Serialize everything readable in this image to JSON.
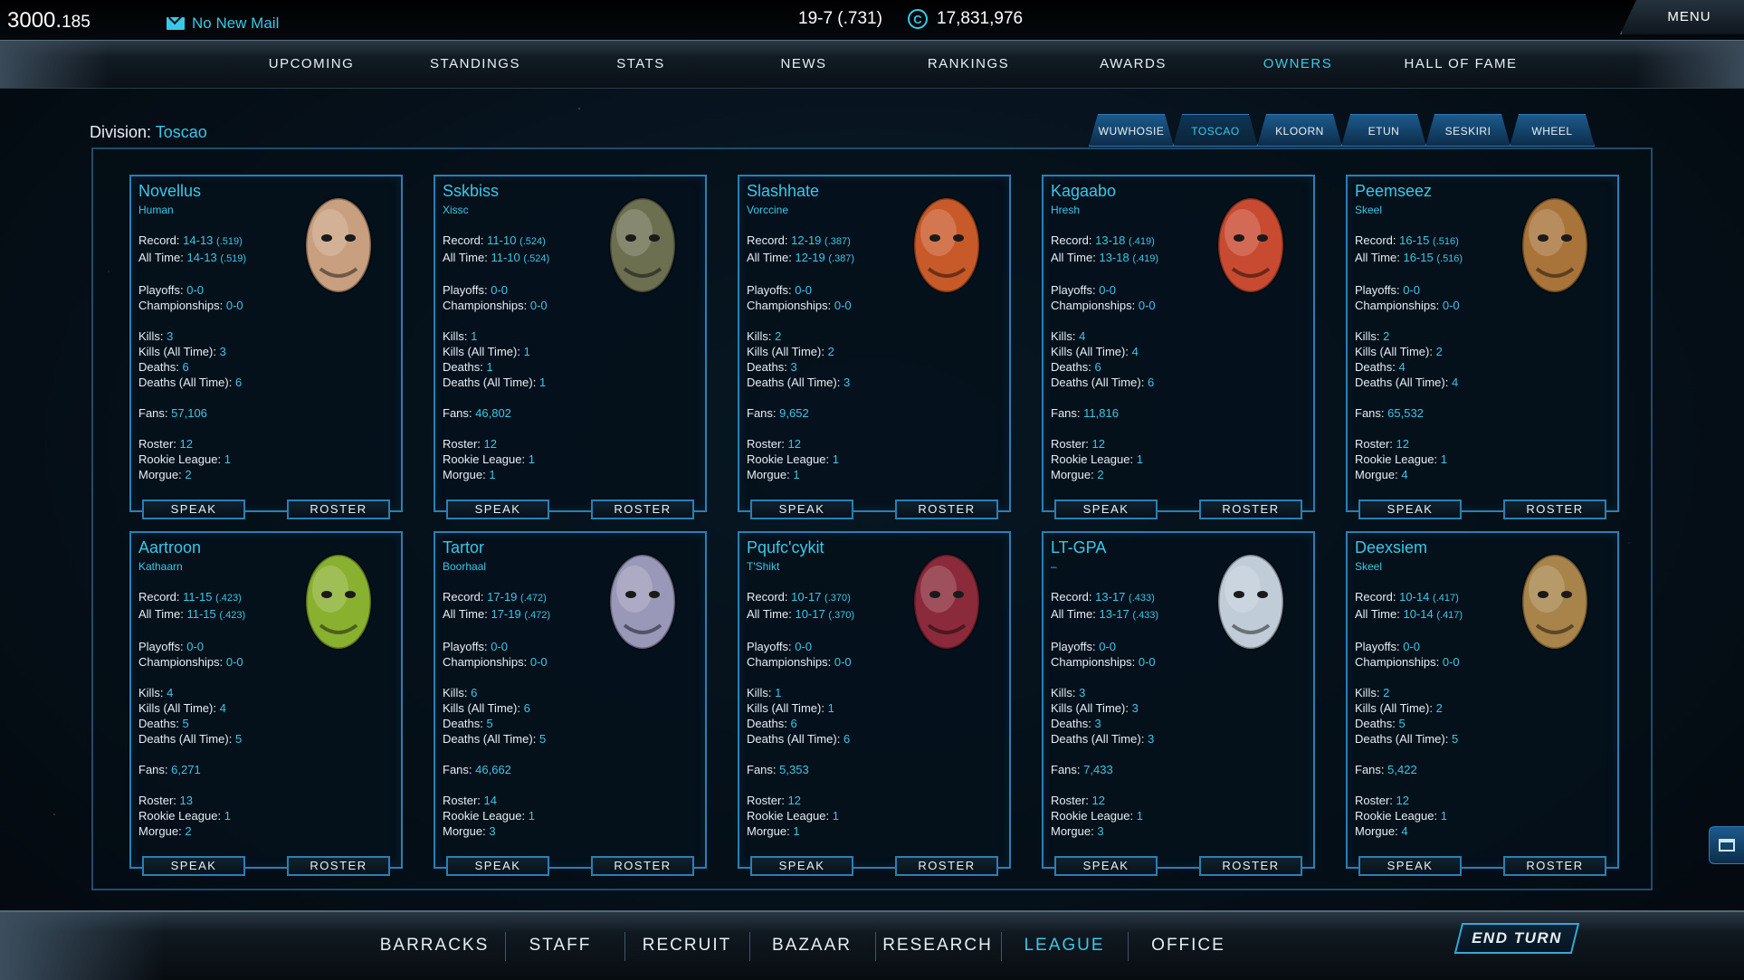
{
  "top": {
    "score_main": "3000.",
    "score_frac": "185",
    "mail": "No New Mail",
    "record": "19-7 (.731)",
    "credits_icon": "C",
    "credits": "17,831,976",
    "menu": "MENU"
  },
  "nav": [
    {
      "label": "UPCOMING"
    },
    {
      "label": "STANDINGS"
    },
    {
      "label": "STATS"
    },
    {
      "label": "NEWS"
    },
    {
      "label": "RANKINGS"
    },
    {
      "label": "AWARDS"
    },
    {
      "label": "OWNERS"
    },
    {
      "label": "HALL OF FAME"
    }
  ],
  "division": {
    "label": "Division:",
    "value": "Toscao"
  },
  "tabs": [
    {
      "label": "WUWHOSIE"
    },
    {
      "label": "TOSCAO"
    },
    {
      "label": "KLOORN"
    },
    {
      "label": "ETUN"
    },
    {
      "label": "SESKIRI"
    },
    {
      "label": "WHEEL"
    }
  ],
  "labels": {
    "record": "Record:",
    "alltime": "All Time:",
    "playoffs": "Playoffs:",
    "championships": "Championships:",
    "kills": "Kills:",
    "kills_all": "Kills (All Time):",
    "deaths": "Deaths:",
    "deaths_all": "Deaths (All Time):",
    "fans": "Fans:",
    "roster": "Roster:",
    "rookie": "Rookie League:",
    "morgue": "Morgue:",
    "speak_btn": "SPEAK",
    "roster_btn": "ROSTER"
  },
  "owners": [
    {
      "name": "Novellus",
      "race": "Human",
      "record": "14-13",
      "record_pct": "(.519)",
      "alltime": "14-13",
      "alltime_pct": "(.519)",
      "playoffs": "0-0",
      "championships": "0-0",
      "kills": "3",
      "kills_all": "3",
      "deaths": "6",
      "deaths_all": "6",
      "fans": "57,106",
      "roster": "12",
      "rookie": "1",
      "morgue": "2",
      "portrait_color": "#c8a080"
    },
    {
      "name": "Sskbiss",
      "race": "Xissc",
      "record": "11-10",
      "record_pct": "(.524)",
      "alltime": "11-10",
      "alltime_pct": "(.524)",
      "playoffs": "0-0",
      "championships": "0-0",
      "kills": "1",
      "kills_all": "1",
      "deaths": "1",
      "deaths_all": "1",
      "fans": "46,802",
      "roster": "12",
      "rookie": "1",
      "morgue": "1",
      "portrait_color": "#6c7050"
    },
    {
      "name": "Slashhate",
      "race": "Vorccine",
      "record": "12-19",
      "record_pct": "(.387)",
      "alltime": "12-19",
      "alltime_pct": "(.387)",
      "playoffs": "0-0",
      "championships": "0-0",
      "kills": "2",
      "kills_all": "2",
      "deaths": "3",
      "deaths_all": "3",
      "fans": "9,652",
      "roster": "12",
      "rookie": "1",
      "morgue": "1",
      "portrait_color": "#c85a2a"
    },
    {
      "name": "Kagaabo",
      "race": "Hresh",
      "record": "13-18",
      "record_pct": "(.419)",
      "alltime": "13-18",
      "alltime_pct": "(.419)",
      "playoffs": "0-0",
      "championships": "0-0",
      "kills": "4",
      "kills_all": "4",
      "deaths": "6",
      "deaths_all": "6",
      "fans": "11,816",
      "roster": "12",
      "rookie": "1",
      "morgue": "2",
      "portrait_color": "#c84a30"
    },
    {
      "name": "Peemseez",
      "race": "Skeel",
      "record": "16-15",
      "record_pct": "(.516)",
      "alltime": "16-15",
      "alltime_pct": "(.516)",
      "playoffs": "0-0",
      "championships": "0-0",
      "kills": "2",
      "kills_all": "2",
      "deaths": "4",
      "deaths_all": "4",
      "fans": "65,532",
      "roster": "12",
      "rookie": "1",
      "morgue": "4",
      "portrait_color": "#a8743a"
    },
    {
      "name": "Aartroon",
      "race": "Kathaarn",
      "record": "11-15",
      "record_pct": "(.423)",
      "alltime": "11-15",
      "alltime_pct": "(.423)",
      "playoffs": "0-0",
      "championships": "0-0",
      "kills": "4",
      "kills_all": "4",
      "deaths": "5",
      "deaths_all": "5",
      "fans": "6,271",
      "roster": "13",
      "rookie": "1",
      "morgue": "2",
      "portrait_color": "#8ab030"
    },
    {
      "name": "Tartor",
      "race": "Boorhaal",
      "record": "17-19",
      "record_pct": "(.472)",
      "alltime": "17-19",
      "alltime_pct": "(.472)",
      "playoffs": "0-0",
      "championships": "0-0",
      "kills": "6",
      "kills_all": "6",
      "deaths": "5",
      "deaths_all": "5",
      "fans": "46,662",
      "roster": "14",
      "rookie": "1",
      "morgue": "3",
      "portrait_color": "#9a98b8"
    },
    {
      "name": "Pqufc'cykit",
      "race": "T'Shikt",
      "record": "10-17",
      "record_pct": "(.370)",
      "alltime": "10-17",
      "alltime_pct": "(.370)",
      "playoffs": "0-0",
      "championships": "0-0",
      "kills": "1",
      "kills_all": "1",
      "deaths": "6",
      "deaths_all": "6",
      "fans": "5,353",
      "roster": "12",
      "rookie": "1",
      "morgue": "1",
      "portrait_color": "#8a2a3a"
    },
    {
      "name": "LT-GPA",
      "race": "–",
      "record": "13-17",
      "record_pct": "(.433)",
      "alltime": "13-17",
      "alltime_pct": "(.433)",
      "playoffs": "0-0",
      "championships": "0-0",
      "kills": "3",
      "kills_all": "3",
      "deaths": "3",
      "deaths_all": "3",
      "fans": "7,433",
      "roster": "12",
      "rookie": "1",
      "morgue": "3",
      "portrait_color": "#c0ccd8"
    },
    {
      "name": "Deexsiem",
      "race": "Skeel",
      "record": "10-14",
      "record_pct": "(.417)",
      "alltime": "10-14",
      "alltime_pct": "(.417)",
      "playoffs": "0-0",
      "championships": "0-0",
      "kills": "2",
      "kills_all": "2",
      "deaths": "5",
      "deaths_all": "5",
      "fans": "5,422",
      "roster": "12",
      "rookie": "1",
      "morgue": "4",
      "portrait_color": "#a8844a"
    }
  ],
  "bottom_nav": [
    {
      "label": "BARRACKS"
    },
    {
      "label": "STAFF"
    },
    {
      "label": "RECRUIT"
    },
    {
      "label": "BAZAAR"
    },
    {
      "label": "RESEARCH"
    },
    {
      "label": "LEAGUE"
    },
    {
      "label": "OFFICE"
    }
  ],
  "end_turn": "END TURN",
  "icons": {
    "mail": "mail-icon",
    "credits": "credits-icon",
    "side": "ship-icon"
  },
  "colors": {
    "accent": "#38c8e8",
    "border": "#2a7fb4",
    "text": "#e6eef5"
  }
}
